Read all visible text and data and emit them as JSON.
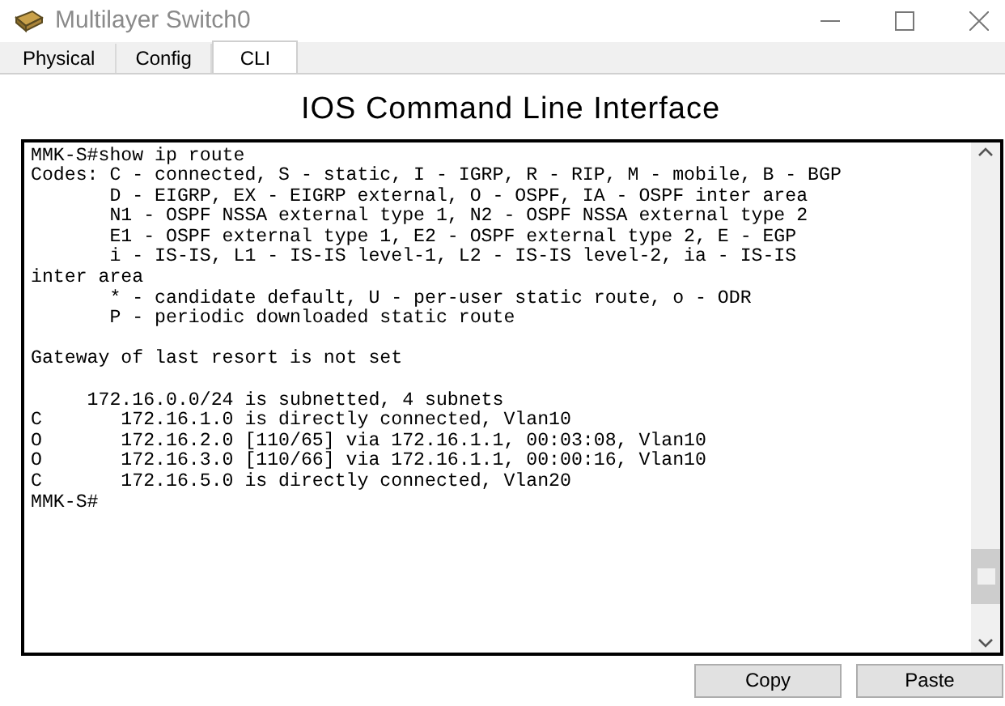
{
  "window": {
    "title": "Multilayer Switch0"
  },
  "tabs": [
    {
      "label": "Physical",
      "selected": false
    },
    {
      "label": "Config",
      "selected": false
    },
    {
      "label": "CLI",
      "selected": true
    }
  ],
  "heading": "IOS Command Line Interface",
  "terminal": {
    "blocks": [
      [
        "MMK-S#show ip route",
        "Codes: C - connected, S - static, I - IGRP, R - RIP, M - mobile, B - BGP",
        "       D - EIGRP, EX - EIGRP external, O - OSPF, IA - OSPF inter area",
        "       N1 - OSPF NSSA external type 1, N2 - OSPF NSSA external type 2",
        "       E1 - OSPF external type 1, E2 - OSPF external type 2, E - EGP",
        "       i - IS-IS, L1 - IS-IS level-1, L2 - IS-IS level-2, ia - IS-IS",
        "inter area",
        "       * - candidate default, U - per-user static route, o - ODR",
        "       P - periodic downloaded static route"
      ],
      [
        "Gateway of last resort is not set"
      ],
      [
        "     172.16.0.0/24 is subnetted, 4 subnets",
        "C       172.16.1.0 is directly connected, Vlan10",
        "O       172.16.2.0 [110/65] via 172.16.1.1, 00:03:08, Vlan10",
        "O       172.16.3.0 [110/66] via 172.16.1.1, 00:00:16, Vlan10",
        "C       172.16.5.0 is directly connected, Vlan20",
        "MMK-S#"
      ]
    ]
  },
  "buttons": [
    "Copy",
    "Paste"
  ]
}
